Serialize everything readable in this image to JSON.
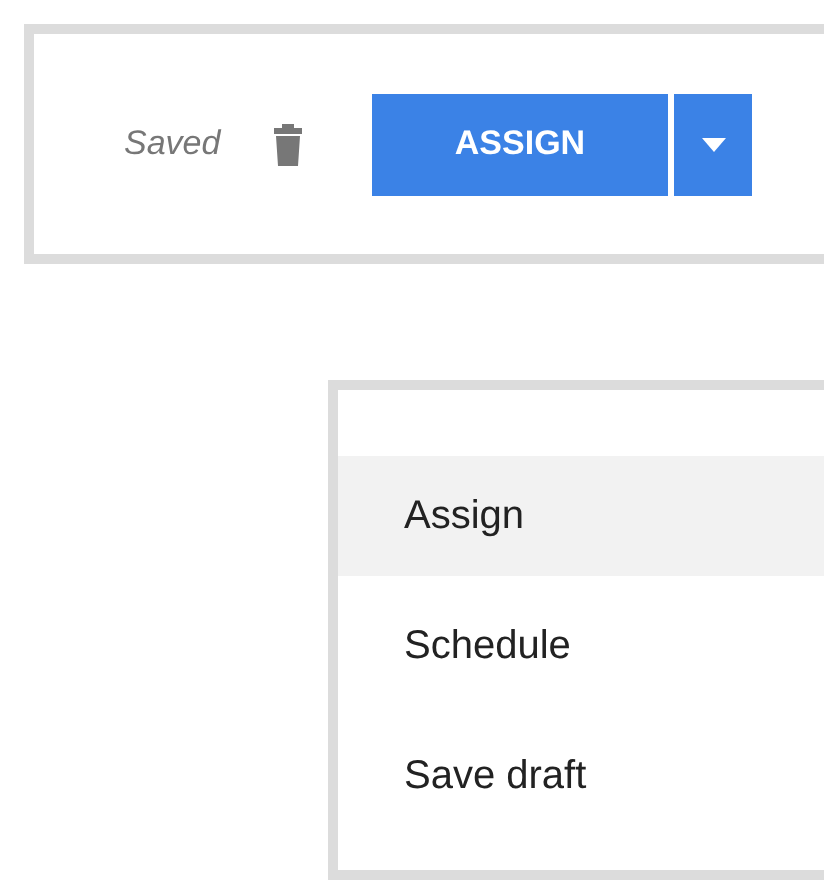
{
  "toolbar": {
    "status": "Saved",
    "primary_button": {
      "label": "ASSIGN"
    }
  },
  "menu": {
    "items": [
      {
        "label": "Assign",
        "selected": true
      },
      {
        "label": "Schedule",
        "selected": false
      },
      {
        "label": "Save draft",
        "selected": false
      }
    ]
  }
}
